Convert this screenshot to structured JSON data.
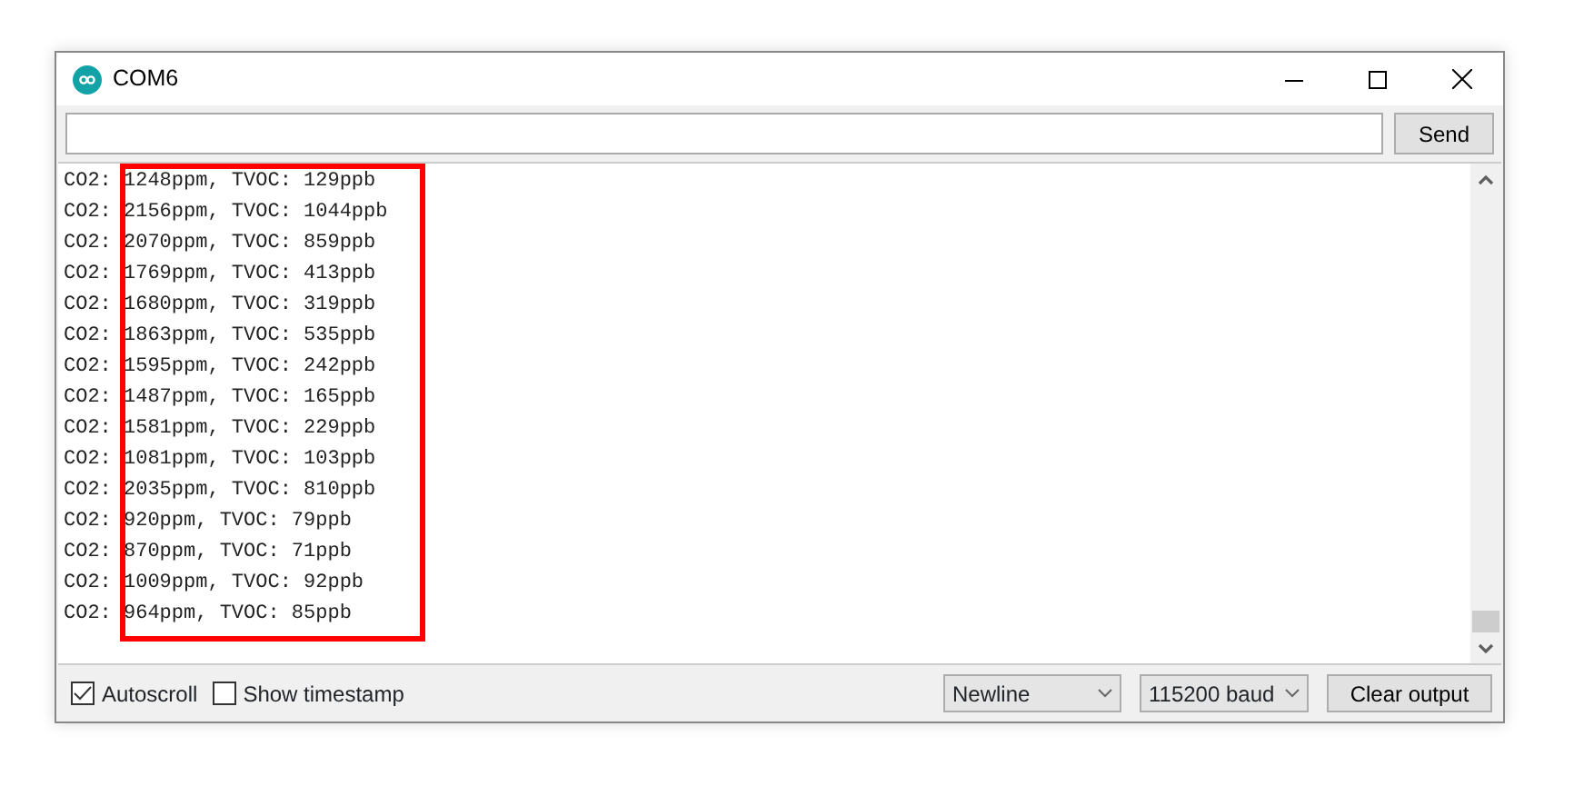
{
  "window": {
    "title": "COM6"
  },
  "input": {
    "send_button": "Send"
  },
  "output_lines": [
    "CO2: 1248ppm, TVOC: 129ppb",
    "CO2: 2156ppm, TVOC: 1044ppb",
    "CO2: 2070ppm, TVOC: 859ppb",
    "CO2: 1769ppm, TVOC: 413ppb",
    "CO2: 1680ppm, TVOC: 319ppb",
    "CO2: 1863ppm, TVOC: 535ppb",
    "CO2: 1595ppm, TVOC: 242ppb",
    "CO2: 1487ppm, TVOC: 165ppb",
    "CO2: 1581ppm, TVOC: 229ppb",
    "CO2: 1081ppm, TVOC: 103ppb",
    "CO2: 2035ppm, TVOC: 810ppb",
    "CO2: 920ppm, TVOC: 79ppb",
    "CO2: 870ppm, TVOC: 71ppb",
    "CO2: 1009ppm, TVOC: 92ppb",
    "CO2: 964ppm, TVOC: 85ppb"
  ],
  "footer": {
    "checkboxes": [
      {
        "label": "Autoscroll",
        "checked": true
      },
      {
        "label": "Show timestamp",
        "checked": false
      }
    ],
    "line_ending": "Newline",
    "baud_rate": "115200 baud",
    "clear_button": "Clear output"
  }
}
